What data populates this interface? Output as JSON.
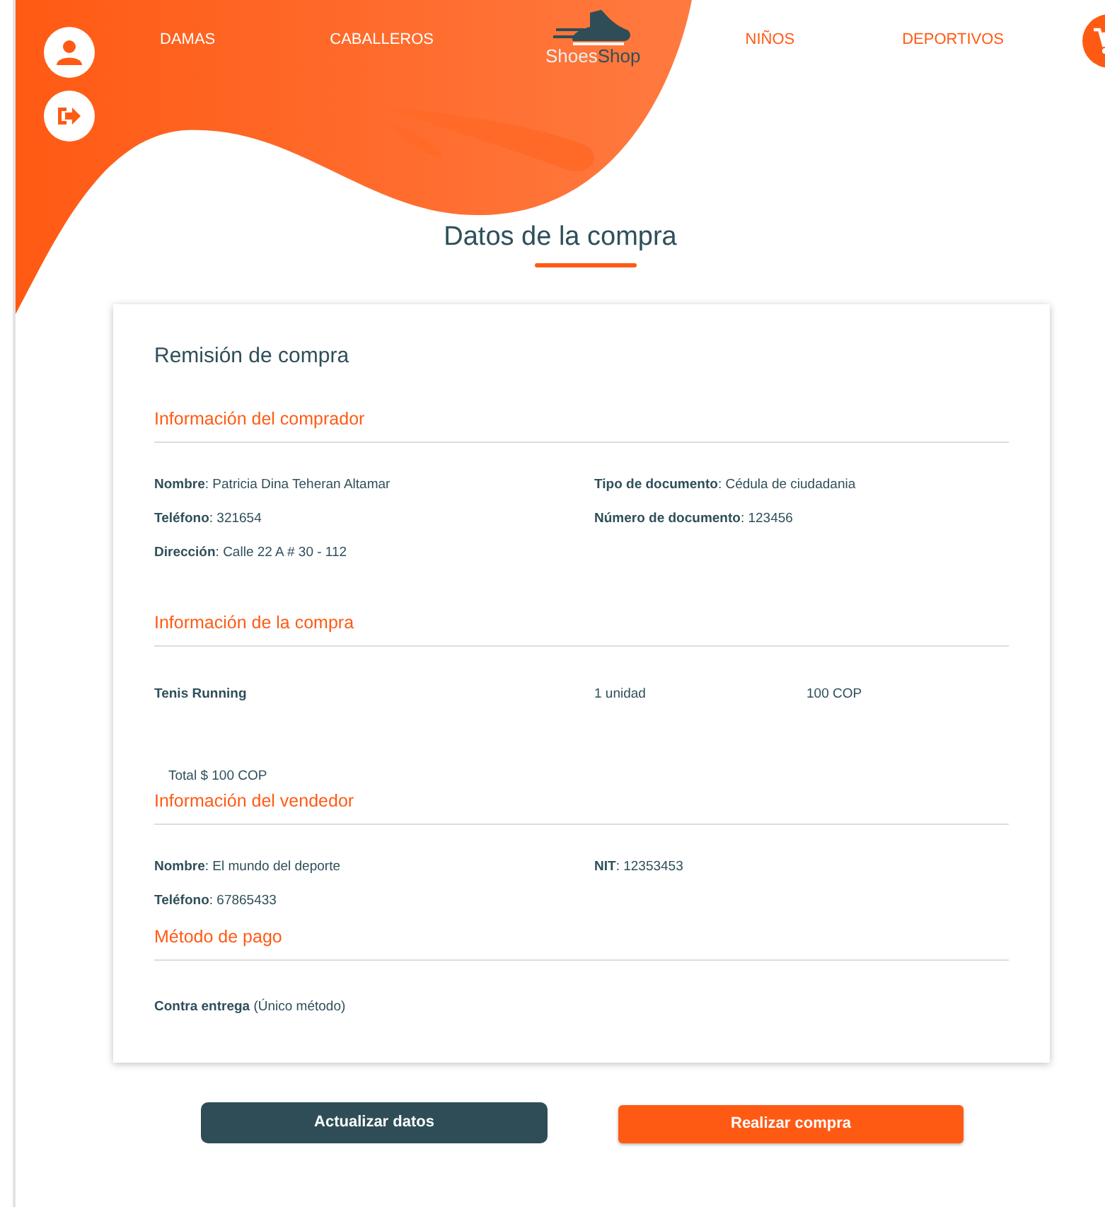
{
  "header": {
    "nav_left": [
      "DAMAS",
      "CABALLEROS"
    ],
    "logo": {
      "text_1": "Shoes",
      "text_2": "Shop"
    },
    "nav_right": [
      "NIÑOS",
      "DEPORTIVOS"
    ]
  },
  "title": "Datos de la compra",
  "card": {
    "heading": "Remisión de compra",
    "sections": [
      {
        "kind": "fields",
        "title": "Información del comprador",
        "columns": [
          [
            "**Nombre**: Patricia Dina Teheran Altamar",
            "**Teléfono**: 321654",
            "**Dirección**: Calle 22 A # 30 - 112"
          ],
          [
            "**Tipo de documento**: Cédula de ciudadania",
            "**Número de documento**: 123456"
          ]
        ]
      },
      {
        "kind": "items",
        "title": "Información de la compra",
        "items": [
          {
            "name": "Tenis Running",
            "quantity": "1 unidad",
            "price": "100 COP"
          }
        ],
        "total": "Total $ 100 COP"
      },
      {
        "kind": "fields",
        "title": "Información del vendedor",
        "columns": [
          [
            "**Nombre**: El mundo del deporte",
            "**Teléfono**: 67865433"
          ],
          [
            "**NIT**: 12353453"
          ]
        ]
      },
      {
        "kind": "fields",
        "title": "Método de pago",
        "columns": [
          [
            "**Contra entrega** (Único método)"
          ]
        ]
      }
    ]
  },
  "buttons": [
    {
      "label": "Actualizar datos",
      "kind": "secondary"
    },
    {
      "label": "Realizar compra",
      "kind": "primary"
    }
  ]
}
